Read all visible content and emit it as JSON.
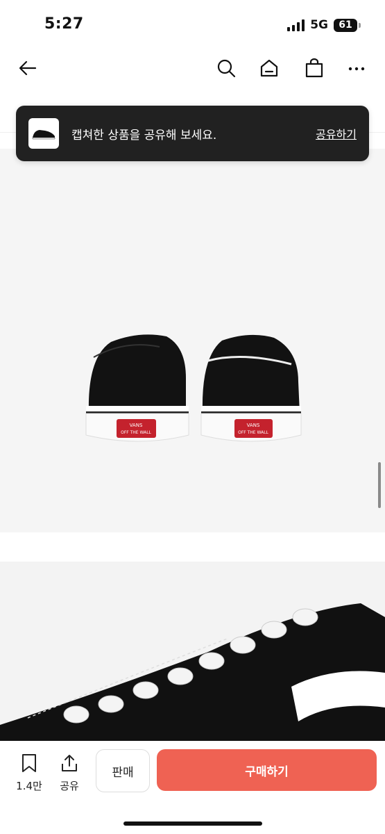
{
  "status_bar": {
    "time": "5:27",
    "network": "5G",
    "battery": "61"
  },
  "nav": {
    "icons": [
      "back-arrow-icon",
      "search-icon",
      "home-icon",
      "shopping-bag-icon",
      "more-icon"
    ]
  },
  "toast": {
    "message": "캡쳐한 상품을 공유해 보세요.",
    "action": "공유하기"
  },
  "product_images": [
    {
      "description_icon": "shoe-rear-view-image",
      "patch_text": "VANS OFF THE WALL"
    },
    {
      "description_icon": "shoe-laces-closeup-image"
    }
  ],
  "bottom_bar": {
    "bookmark_count": "1.4만",
    "share_label": "공유",
    "sell_label": "판매",
    "buy_label": "구매하기"
  },
  "colors": {
    "buy_button": "#ef6253",
    "toast_bg": "#212121"
  }
}
